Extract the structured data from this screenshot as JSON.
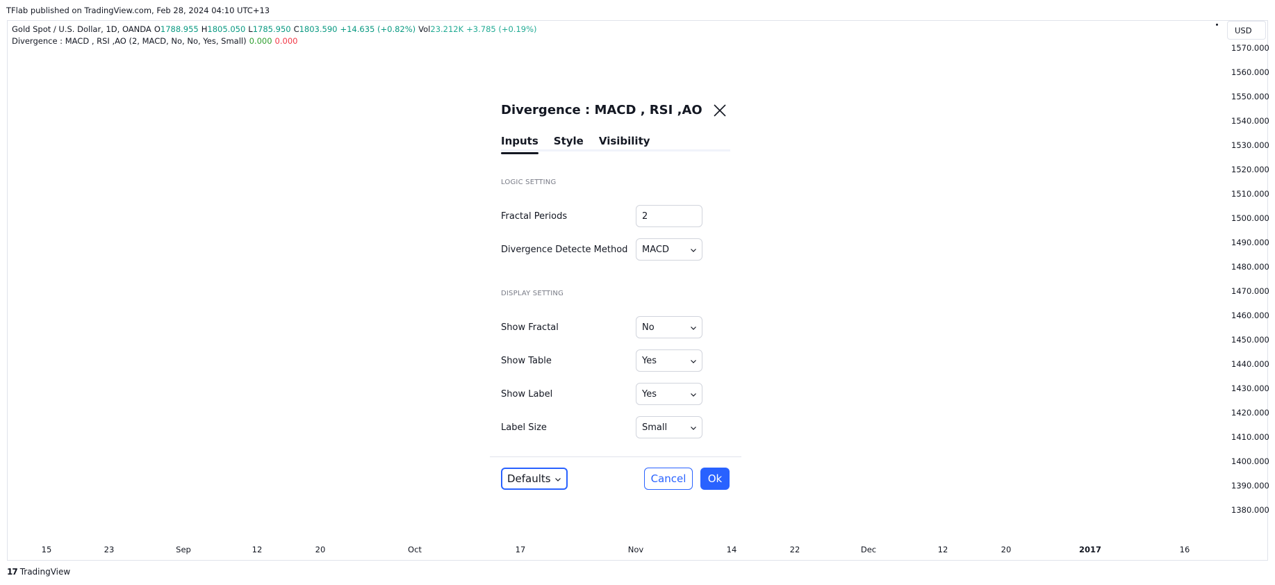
{
  "published": "TFlab published on TradingView.com, Feb 28, 2024 04:10 UTC+13",
  "legend": {
    "symbol": "Gold Spot / U.S. Dollar, 1D, OANDA",
    "o_label": "O",
    "o_value": "1788.955",
    "h_label": "H",
    "h_value": "1805.050",
    "l_label": "L",
    "l_value": "1785.950",
    "c_label": "C",
    "c_value": "1803.590",
    "change": "+14.635 (+0.82%)",
    "vol_label": "Vol",
    "vol_value": "23.212K",
    "vol_change": "+3.785 (+0.19%)",
    "indicator": "Divergence : MACD , RSI ,AO (2, MACD, No, No, Yes, Small)",
    "ind_value1": "0.000",
    "ind_value2": "0.000"
  },
  "currency": "USD",
  "price_scale": [
    "1570.000",
    "1560.000",
    "1550.000",
    "1540.000",
    "1530.000",
    "1520.000",
    "1510.000",
    "1500.000",
    "1490.000",
    "1480.000",
    "1470.000",
    "1460.000",
    "1450.000",
    "1440.000",
    "1430.000",
    "1420.000",
    "1410.000",
    "1400.000",
    "1390.000",
    "1380.000"
  ],
  "time_axis": [
    "15",
    "23",
    "Sep",
    "12",
    "20",
    "Oct",
    "17",
    "Nov",
    "14",
    "22",
    "Dec",
    "12",
    "20",
    "2017",
    "16"
  ],
  "brand": "TradingView",
  "dialog": {
    "title": "Divergence : MACD , RSI ,AO",
    "tabs": [
      "Inputs",
      "Style",
      "Visibility"
    ],
    "active_tab": "Inputs",
    "logic_section": "LOGIC SETTING",
    "fractal_periods_label": "Fractal Periods",
    "fractal_periods_value": "2",
    "method_label": "Divergence Detecte Method",
    "method_value": "MACD",
    "display_section": "DISPLAY SETTING",
    "show_fractal_label": "Show Fractal",
    "show_fractal_value": "No",
    "show_table_label": "Show Table",
    "show_table_value": "Yes",
    "show_label_label": "Show Label",
    "show_label_value": "Yes",
    "label_size_label": "Label Size",
    "label_size_value": "Small",
    "defaults": "Defaults",
    "cancel": "Cancel",
    "ok": "Ok"
  }
}
